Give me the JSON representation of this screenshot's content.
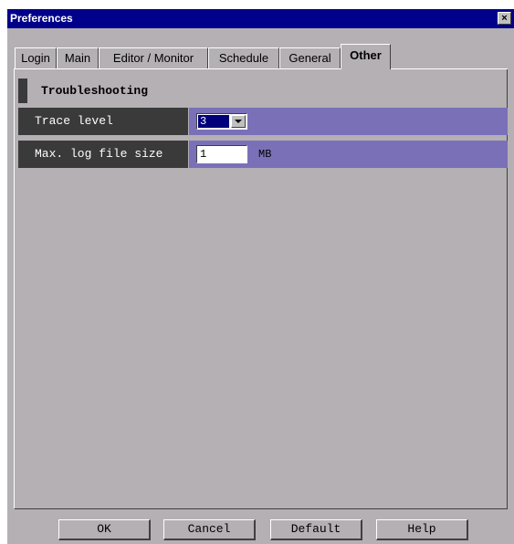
{
  "window": {
    "title": "Preferences",
    "close_label": "×"
  },
  "tabs": [
    {
      "label": "Login"
    },
    {
      "label": "Main"
    },
    {
      "label": "Editor / Monitor"
    },
    {
      "label": "Schedule"
    },
    {
      "label": "General"
    },
    {
      "label": "Other",
      "active": true
    }
  ],
  "section": {
    "title": "Troubleshooting"
  },
  "settings": {
    "trace_level": {
      "label": "Trace level",
      "value": "3"
    },
    "max_log_file_size": {
      "label": "Max. log file size",
      "value": "1",
      "unit": "MB"
    }
  },
  "footer": {
    "ok_label": "OK",
    "cancel_label": "Cancel",
    "default_label": "Default",
    "help_label": "Help"
  },
  "colors": {
    "title_bar": "#00008b",
    "dialog_bg": "#b5b0b3",
    "label_bg": "#3a3a3a",
    "value_bg": "#7a70b8"
  }
}
